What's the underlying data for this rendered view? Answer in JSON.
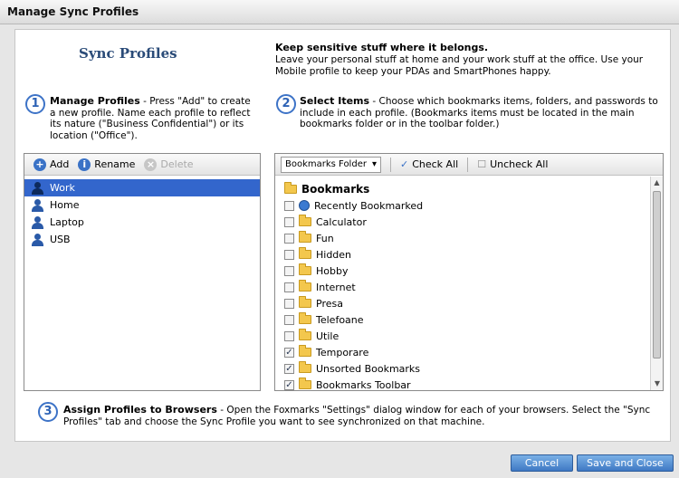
{
  "window": {
    "title": "Manage Sync Profiles"
  },
  "heading": "Sync Profiles",
  "intro": {
    "headline": "Keep sensitive stuff where it belongs.",
    "body": "Leave your personal stuff at home and your work stuff at the office. Use your Mobile profile to keep your PDAs and SmartPhones happy."
  },
  "steps": [
    {
      "number": "1",
      "title": "Manage Profiles",
      "text": " - Press \"Add\" to create a new profile. Name each profile to reflect its nature (\"Business Confidential\") or its location (\"Office\")."
    },
    {
      "number": "2",
      "title": "Select Items",
      "text": " - Choose which bookmarks items, folders, and passwords to include in each profile. (Bookmarks items must be located in the main bookmarks folder or in the toolbar folder.)"
    },
    {
      "number": "3",
      "title": "Assign Profiles to Browsers",
      "text": " - Open the Foxmarks \"Settings\" dialog window for each of your browsers. Select the \"Sync Profiles\" tab and choose the Sync Profile you want to see synchronized on that machine."
    }
  ],
  "profiles_toolbar": {
    "add": "Add",
    "rename": "Rename",
    "delete": "Delete"
  },
  "profiles": [
    {
      "label": "Work"
    },
    {
      "label": "Home"
    },
    {
      "label": "Laptop"
    },
    {
      "label": "USB"
    }
  ],
  "items_toolbar": {
    "folder_select": "Bookmarks Folder",
    "check_all": "Check All",
    "uncheck_all": "Uncheck All"
  },
  "tree": {
    "root": "Bookmarks",
    "items": [
      {
        "label": "Recently Bookmarked",
        "checked": false,
        "icon": "globe-icon"
      },
      {
        "label": "Calculator",
        "checked": false,
        "icon": "folder-icon"
      },
      {
        "label": "Fun",
        "checked": false,
        "icon": "folder-icon"
      },
      {
        "label": "Hidden",
        "checked": false,
        "icon": "folder-icon"
      },
      {
        "label": "Hobby",
        "checked": false,
        "icon": "folder-icon"
      },
      {
        "label": "Internet",
        "checked": false,
        "icon": "folder-icon"
      },
      {
        "label": "Presa",
        "checked": false,
        "icon": "folder-icon"
      },
      {
        "label": "Telefoane",
        "checked": false,
        "icon": "folder-icon"
      },
      {
        "label": "Utile",
        "checked": false,
        "icon": "folder-icon"
      },
      {
        "label": "Temporare",
        "checked": true,
        "icon": "folder-icon"
      },
      {
        "label": "Unsorted Bookmarks",
        "checked": true,
        "icon": "folder-icon"
      },
      {
        "label": "Bookmarks Toolbar",
        "checked": true,
        "icon": "folder-icon"
      }
    ]
  },
  "buttons": {
    "cancel": "Cancel",
    "save": "Save and Close"
  },
  "colors": {
    "accent": "#3366cc",
    "heading": "#2a4b78",
    "button": "#3f79c4"
  }
}
